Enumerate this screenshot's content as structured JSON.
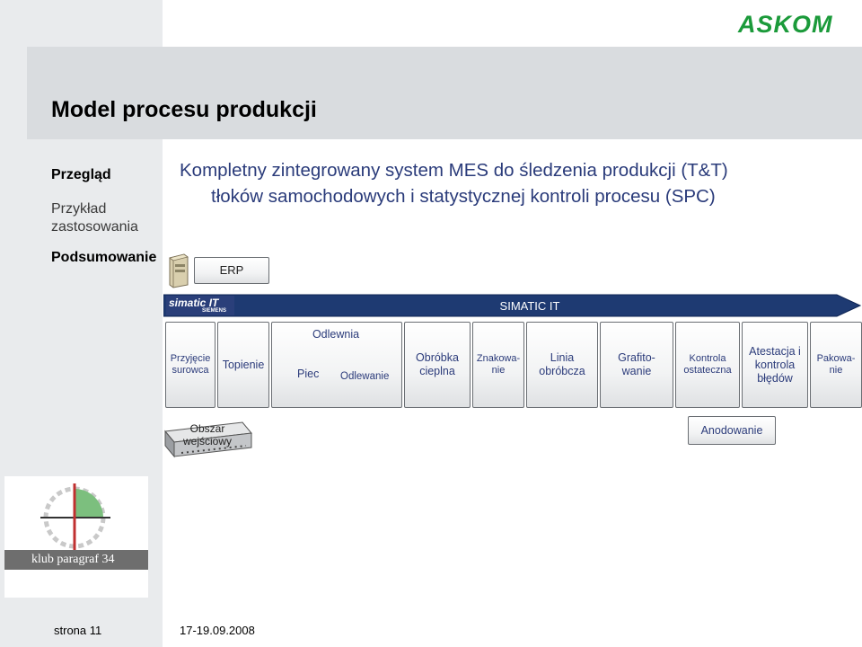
{
  "slide": {
    "title": "Model procesu produkcji",
    "subtitle_line1": "Kompletny zintegrowany system MES do śledzenia produkcji (T&T)",
    "subtitle_line2": "tłoków samochodowych i statystycznej kontroli procesu (SPC)"
  },
  "brand": {
    "logo_text": "ASKOM",
    "logo_color": "#1b9a3a",
    "accent_color": "#2b3b7a"
  },
  "nav": {
    "overview": "Przegląd",
    "example": "Przykład zastosowania",
    "summary": "Podsumowanie"
  },
  "diagram": {
    "erp_label": "ERP",
    "simatic_label": "SIMATIC IT",
    "simatic_logo_text": "simatic IT",
    "siemens_text": "SIEMENS",
    "steps": {
      "intake": "Przyjęcie surowca",
      "melting": "Topienie",
      "foundry": "Odlewnia",
      "furnace": "Piec",
      "casting": "Odlewanie",
      "heat": "Obróbka cieplna",
      "marking": "Znakowa-nie",
      "machining": "Linia obróbcza",
      "graphite": "Grafito-wanie",
      "final": "Kontrola ostateczna",
      "attest": "Atestacja i kontrola błędów",
      "packing": "Pakowa-nie"
    },
    "input_area": "Obszar wejściowy",
    "anodizing": "Anodowanie"
  },
  "footer": {
    "page": "strona 11",
    "date": "17-19.09.2008"
  },
  "klub_logo": {
    "text": "klub paragraf 34"
  }
}
